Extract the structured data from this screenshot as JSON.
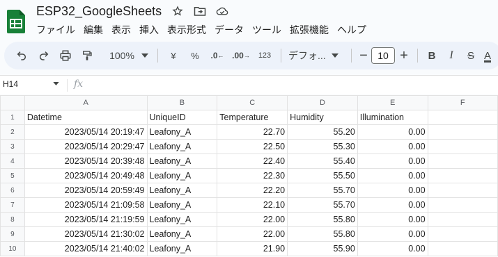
{
  "doc": {
    "title": "ESP32_GoogleSheets",
    "icons": [
      "star-icon",
      "move-to-folder-icon",
      "cloud-saved-icon"
    ]
  },
  "menu": [
    "ファイル",
    "編集",
    "表示",
    "挿入",
    "表示形式",
    "データ",
    "ツール",
    "拡張機能",
    "ヘルプ"
  ],
  "toolbar": {
    "zoom": "100%",
    "currency": "¥",
    "percent": "%",
    "dec_decrease": ".0",
    "dec_increase": ".00",
    "number_format": "123",
    "font": "デフォ...",
    "font_size": "10",
    "bold": "B",
    "italic": "I",
    "strike": "S",
    "text_color": "A"
  },
  "formula_bar": {
    "cell_ref": "H14",
    "fx": "fx",
    "value": ""
  },
  "sheet": {
    "columns": [
      "A",
      "B",
      "C",
      "D",
      "E",
      "F"
    ],
    "rows": [
      {
        "n": "1",
        "cells": [
          "Datetime",
          "UniqueID",
          "Temperature",
          "Humidity",
          "Illumination",
          ""
        ]
      },
      {
        "n": "2",
        "cells": [
          "2023/05/14 20:19:47",
          "Leafony_A",
          "22.70",
          "55.20",
          "0.00",
          ""
        ]
      },
      {
        "n": "3",
        "cells": [
          "2023/05/14 20:29:47",
          "Leafony_A",
          "22.50",
          "55.30",
          "0.00",
          ""
        ]
      },
      {
        "n": "4",
        "cells": [
          "2023/05/14 20:39:48",
          "Leafony_A",
          "22.40",
          "55.40",
          "0.00",
          ""
        ]
      },
      {
        "n": "5",
        "cells": [
          "2023/05/14 20:49:48",
          "Leafony_A",
          "22.30",
          "55.50",
          "0.00",
          ""
        ]
      },
      {
        "n": "6",
        "cells": [
          "2023/05/14 20:59:49",
          "Leafony_A",
          "22.20",
          "55.70",
          "0.00",
          ""
        ]
      },
      {
        "n": "7",
        "cells": [
          "2023/05/14 21:09:58",
          "Leafony_A",
          "22.10",
          "55.70",
          "0.00",
          ""
        ]
      },
      {
        "n": "8",
        "cells": [
          "2023/05/14 21:19:59",
          "Leafony_A",
          "22.00",
          "55.80",
          "0.00",
          ""
        ]
      },
      {
        "n": "9",
        "cells": [
          "2023/05/14 21:30:02",
          "Leafony_A",
          "22.00",
          "55.80",
          "0.00",
          ""
        ]
      },
      {
        "n": "10",
        "cells": [
          "2023/05/14 21:40:02",
          "Leafony_A",
          "21.90",
          "55.90",
          "0.00",
          ""
        ]
      }
    ]
  },
  "colors": {
    "sheets_green": "#188038",
    "toolbar_bg": "#edf2fa",
    "header_bg": "#f8f9fa"
  }
}
